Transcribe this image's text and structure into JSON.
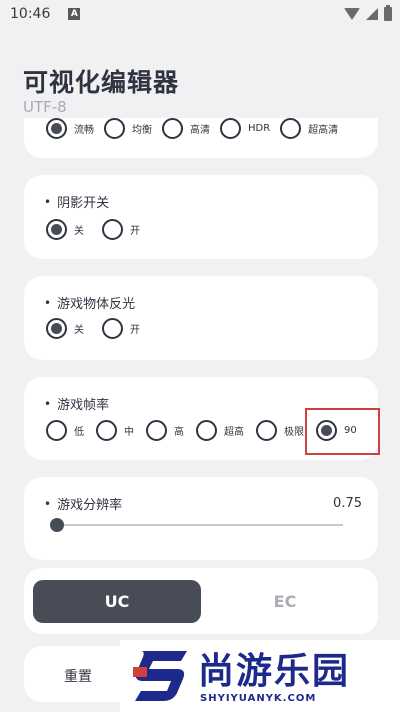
{
  "status": {
    "time": "10:46",
    "notif_letter": "A"
  },
  "app": {
    "title": "可视化编辑器",
    "subtitle": "UTF-8"
  },
  "quality": {
    "options": [
      "流畅",
      "均衡",
      "高清",
      "HDR",
      "超高清"
    ],
    "selected": "流畅"
  },
  "shadow": {
    "label": "阴影开关",
    "options": [
      "关",
      "开"
    ],
    "selected": "关"
  },
  "reflection": {
    "label": "游戏物体反光",
    "options": [
      "关",
      "开"
    ],
    "selected": "关"
  },
  "framerate": {
    "label": "游戏帧率",
    "options": [
      "低",
      "中",
      "高",
      "超高",
      "极限",
      "90"
    ],
    "selected": "90"
  },
  "resolution": {
    "label": "游戏分辨率",
    "value": "0.75",
    "slider_fraction": 0.0
  },
  "mode": {
    "uc": "UC",
    "ec": "EC",
    "selected": "UC"
  },
  "reset": {
    "label": "重置"
  },
  "watermark": {
    "brand": "尚游乐园",
    "domain": "SHYIYUANYK.COM"
  },
  "colors": {
    "accent": "#474c57",
    "highlight": "#d0413e",
    "watermark": "#1d2a8c"
  }
}
